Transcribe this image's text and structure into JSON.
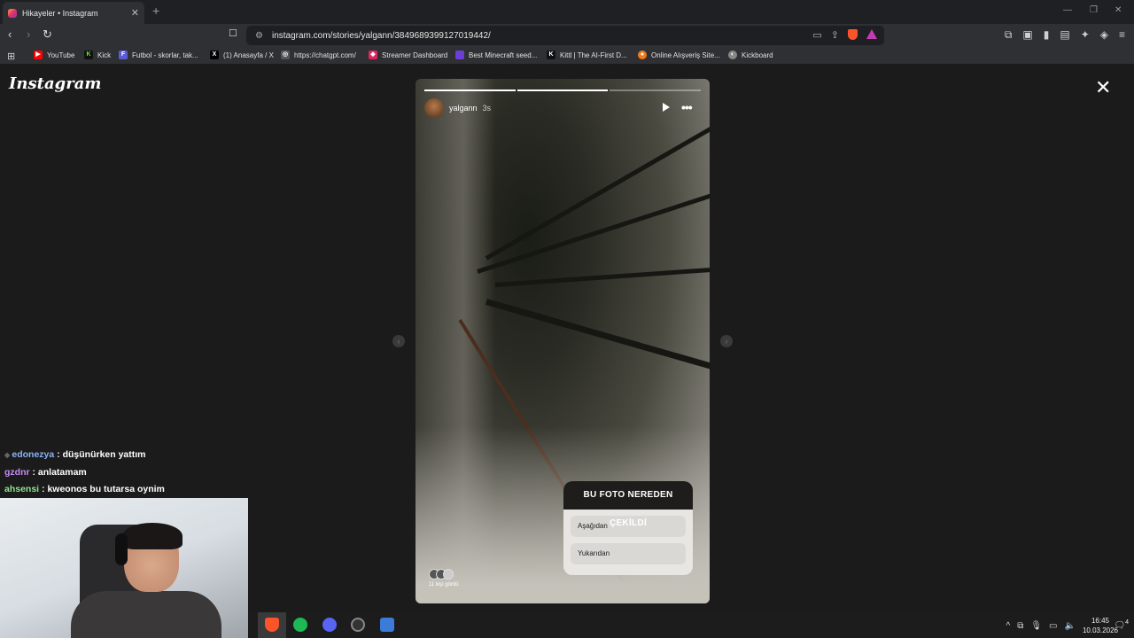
{
  "browser": {
    "tab_title": "Hikayeler • Instagram",
    "new_tab": "+",
    "url": "instagram.com/stories/yalgann/3849689399127019442/",
    "bookmarks": [
      {
        "label": "YouTube",
        "color": "#ff0000"
      },
      {
        "label": "Kick",
        "color": "#53fc18"
      },
      {
        "label": "Futbol - skorlar, tak...",
        "color": "#5b5bd6"
      },
      {
        "label": "(1) Anasayfa / X",
        "color": "#000000"
      },
      {
        "label": "https://chatgpt.com/",
        "color": "#888888"
      },
      {
        "label": "Streamer Dashboard",
        "color": "#e0245e"
      },
      {
        "label": "Best Minecraft seed...",
        "color": "#6b3fd6"
      },
      {
        "label": "Kittl | The AI-First D...",
        "color": "#111111"
      },
      {
        "label": "Online Alışveriş Site...",
        "color": "#f27a1a"
      },
      {
        "label": "Kickboard",
        "color": "#999999"
      }
    ]
  },
  "instagram": {
    "logo": "Instagram",
    "story": {
      "username": "yalgann",
      "time": "3s",
      "progress_segments": 3,
      "active_segment": 2,
      "poll": {
        "question": "BU FOTO NEREDEN ÇEKİLDİ",
        "options": [
          "Aşağıdan",
          "Yukarıdan"
        ]
      },
      "viewers_text": "11 kişi gördü"
    }
  },
  "chat": [
    {
      "user": "edonezya",
      "message": ": düşünürken yattım"
    },
    {
      "user": "gzdnr",
      "message": ": anlatamam"
    },
    {
      "user": "ahsensi",
      "message": ": kweonos bu tutarsa oynim"
    }
  ],
  "taskbar": {
    "time": "16:45",
    "date": "10.03.2026",
    "notif_count": "4"
  }
}
